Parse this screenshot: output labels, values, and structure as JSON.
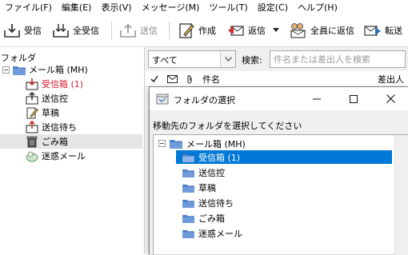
{
  "menu": [
    "ファイル(F)",
    "編集(E)",
    "表示(V)",
    "メッセージ(M)",
    "ツール(T)",
    "設定(C)",
    "ヘルプ(H)"
  ],
  "toolbar": {
    "receive": "受信",
    "receive_all": "全受信",
    "send": "送信",
    "compose": "作成",
    "reply": "返信",
    "reply_all": "全員に返信",
    "forward": "転送"
  },
  "folder_pane": {
    "title": "フォルダ",
    "root": "メール箱 (MH)",
    "items": [
      "受信箱 (1)",
      "送信控",
      "草稿",
      "送信待ち",
      "ごみ箱",
      "迷惑メール"
    ]
  },
  "filter": {
    "selected": "すべて",
    "search_label": "検索:",
    "search_placeholder": "件名または差出人を検索"
  },
  "list_header": {
    "subject": "件名",
    "sender": "差出人"
  },
  "dialog": {
    "title": "フォルダの選択",
    "prompt": "移動先のフォルダを選択してください",
    "root": "メール箱 (MH)",
    "items": [
      "受信箱 (1)",
      "送信控",
      "草稿",
      "送信待ち",
      "ごみ箱",
      "迷惑メール"
    ]
  },
  "colors": {
    "selection": "#0078d7",
    "unread": "#d4202f",
    "folder": "#4f7fc6"
  }
}
